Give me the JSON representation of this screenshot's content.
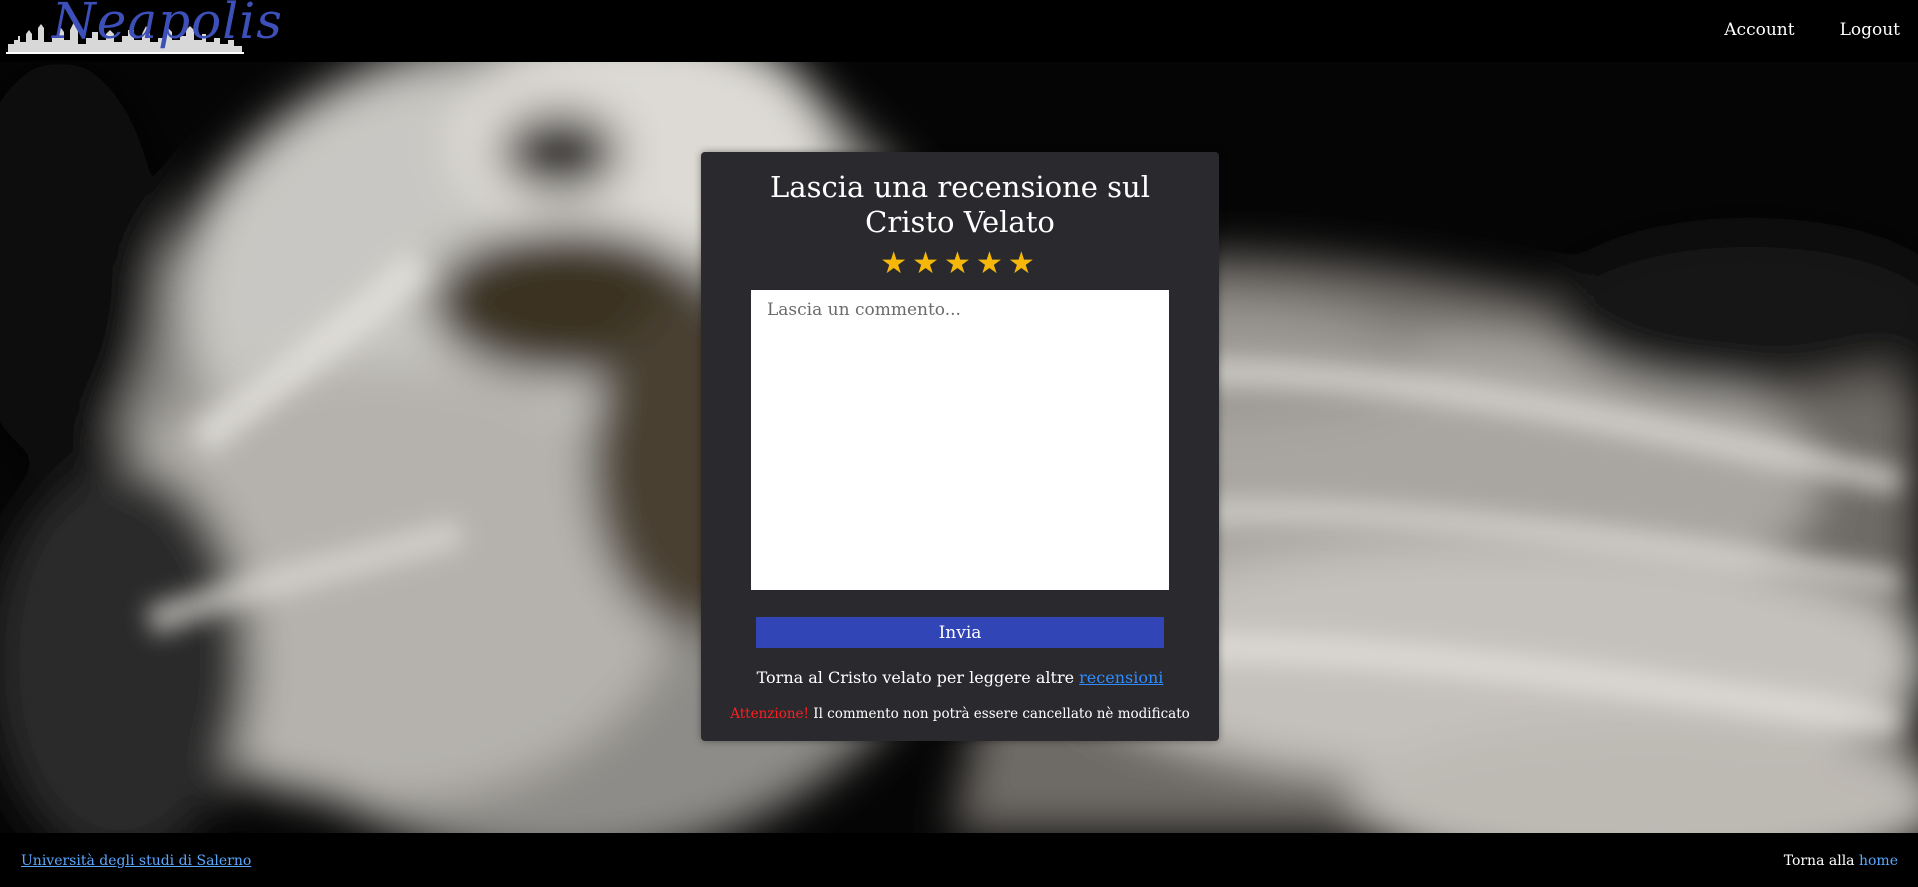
{
  "header": {
    "logo_text": "Neapolis",
    "nav": {
      "account": "Account",
      "logout": "Logout"
    }
  },
  "form": {
    "title": "Lascia una recensione sul Cristo Velato",
    "stars": [
      "★",
      "★",
      "★",
      "★",
      "★"
    ],
    "comment_placeholder": "Lascia un commento...",
    "submit_label": "Invia",
    "back_text": "Torna al Cristo velato per leggere altre",
    "back_link": "recensioni",
    "warning_label": "Attenzione!",
    "warning_text": "Il commento non potrà essere cancellato nè modificato"
  },
  "footer": {
    "left_link": "Università degli studi di Salerno",
    "right_text": "Torna alla",
    "right_link": "home"
  },
  "colors": {
    "accent": "#3145b7",
    "star": "#f5b80a",
    "card": "#2a292e",
    "warning": "#ff1f1f",
    "link": "#2f8cff"
  }
}
